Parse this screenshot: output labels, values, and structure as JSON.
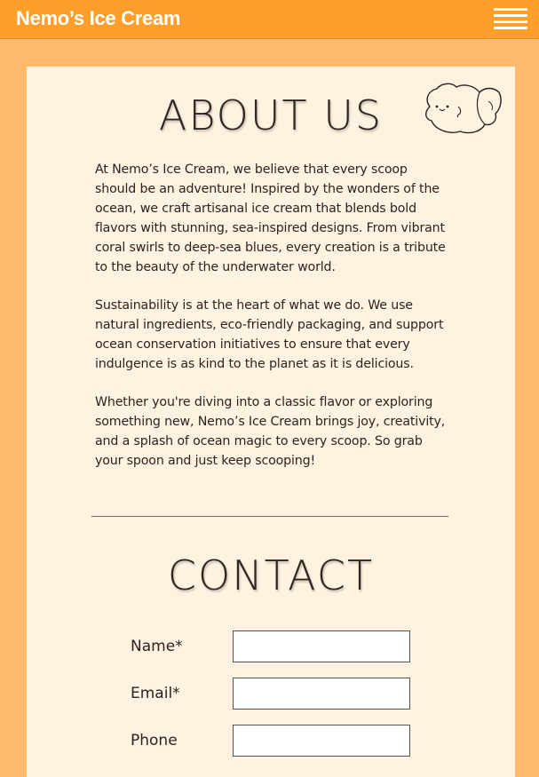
{
  "header": {
    "brand": "Nemo’s Ice Cream",
    "menu_icon": "hamburger-menu-icon",
    "background_color": "#FF9F2B"
  },
  "about": {
    "title": "ABOUT US",
    "mascot_icon": "fish-mascot-icon",
    "paragraphs": [
      "At Nemo’s Ice Cream, we believe that every scoop should be an adventure! Inspired by the wonders of the ocean, we craft artisanal ice cream that blends bold flavors with stunning, sea-inspired designs. From vibrant coral swirls to deep-sea blues, every creation is a tribute to the beauty of the underwater world.",
      "Sustainability is at the heart of what we do. We use natural ingredients, eco-friendly packaging, and support ocean conservation initiatives to ensure that every indulgence is as kind to the planet as it is delicious.",
      "Whether you're diving into a classic flavor or exploring something new, Nemo’s Ice Cream brings joy, creativity, and a splash of ocean magic to every scoop. So grab your spoon and just keep scooping!"
    ]
  },
  "contact": {
    "title": "CONTACT",
    "fields": [
      {
        "label": "Name*",
        "value": ""
      },
      {
        "label": "Email*",
        "value": ""
      },
      {
        "label": "Phone",
        "value": ""
      }
    ]
  },
  "colors": {
    "page_background": "#FFBA6E",
    "card_background": "#FFF2E1",
    "accent": "#FF9F2B"
  }
}
